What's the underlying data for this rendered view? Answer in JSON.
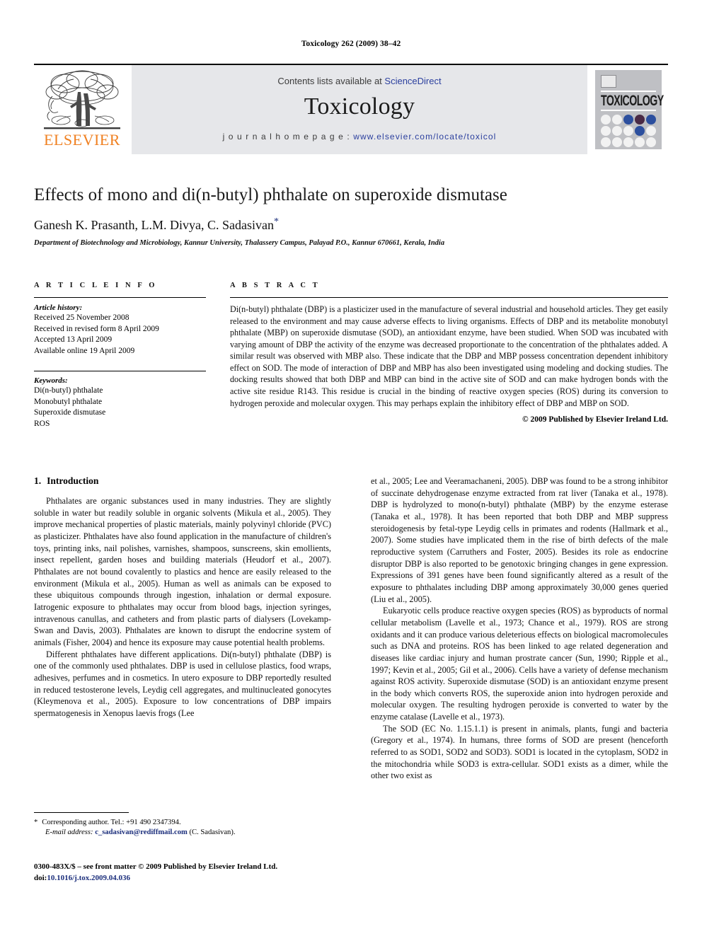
{
  "running_head": "Toxicology 262 (2009) 38–42",
  "masthead": {
    "contents_prefix": "Contents lists available at ",
    "contents_link": "ScienceDirect",
    "journal_name": "Toxicology",
    "homepage_prefix": "j o u r n a l   h o m e p a g e :  ",
    "homepage_url": "www.elsevier.com/locate/toxicol",
    "publisher_logo_text": "ELSEVIER",
    "cover_title": "TOXICOLOGY",
    "accent_orange": "#f08122",
    "link_blue": "#2b3f9e",
    "band_gray": "#e6e7ea",
    "cover_gray": "#bfc0c4",
    "dot_blue": "#2c4f9e",
    "dot_plum": "#4a2a45"
  },
  "title_block": {
    "title": "Effects of mono and di(n-butyl) phthalate on superoxide dismutase",
    "authors": "Ganesh K. Prasanth, L.M. Divya, C. Sadasivan",
    "corresponding_mark": "*",
    "affiliation": "Department of Biotechnology and Microbiology, Kannur University, Thalassery Campus, Palayad P.O., Kannur 670661, Kerala, India"
  },
  "article_info": {
    "heading": "A R T I C L E   I N F O",
    "history_label": "Article history:",
    "history": [
      "Received 25 November 2008",
      "Received in revised form 8 April 2009",
      "Accepted 13 April 2009",
      "Available online 19 April 2009"
    ],
    "keywords_label": "Keywords:",
    "keywords": [
      "Di(n-butyl) phthalate",
      "Monobutyl phthalate",
      "Superoxide dismutase",
      "ROS"
    ]
  },
  "abstract": {
    "heading": "A B S T R A C T",
    "text": "Di(n-butyl) phthalate (DBP) is a plasticizer used in the manufacture of several industrial and household articles. They get easily released to the environment and may cause adverse effects to living organisms. Effects of DBP and its metabolite monobutyl phthalate (MBP) on superoxide dismutase (SOD), an antioxidant enzyme, have been studied. When SOD was incubated with varying amount of DBP the activity of the enzyme was decreased proportionate to the concentration of the phthalates added. A similar result was observed with MBP also. These indicate that the DBP and MBP possess concentration dependent inhibitory effect on SOD. The mode of interaction of DBP and MBP has also been investigated using modeling and docking studies. The docking results showed that both DBP and MBP can bind in the active site of SOD and can make hydrogen bonds with the active site residue R143. This residue is crucial in the binding of reactive oxygen species (ROS) during its conversion to hydrogen peroxide and molecular oxygen. This may perhaps explain the inhibitory effect of DBP and MBP on SOD.",
    "copyright": "© 2009 Published by Elsevier Ireland Ltd."
  },
  "introduction": {
    "number": "1.",
    "title": "Introduction",
    "left_paragraphs": [
      "Phthalates are organic substances used in many industries. They are slightly soluble in water but readily soluble in organic solvents (Mikula et al., 2005). They improve mechanical properties of plastic materials, mainly polyvinyl chloride (PVC) as plasticizer. Phthalates have also found application in the manufacture of children's toys, printing inks, nail polishes, varnishes, shampoos, sunscreens, skin emollients, insect repellent, garden hoses and building materials (Heudorf et al., 2007). Phthalates are not bound covalently to plastics and hence are easily released to the environment (Mikula et al., 2005). Human as well as animals can be exposed to these ubiquitous compounds through ingestion, inhalation or dermal exposure. Iatrogenic exposure to phthalates may occur from blood bags, injection syringes, intravenous canullas, and catheters and from plastic parts of dialysers (Lovekamp-Swan and Davis, 2003). Phthalates are known to disrupt the endocrine system of animals (Fisher, 2004) and hence its exposure may cause potential health problems.",
      "Different phthalates have different applications. Di(n-butyl) phthalate (DBP) is one of the commonly used phthalates. DBP is used in cellulose plastics, food wraps, adhesives, perfumes and in cosmetics. In utero exposure to DBP reportedly resulted in reduced testosterone levels, Leydig cell aggregates, and multinucleated gonocytes (Kleymenova et al., 2005). Exposure to low concentrations of DBP impairs spermatogenesis in Xenopus laevis frogs (Lee"
    ],
    "right_paragraphs": [
      "et al., 2005; Lee and Veeramachaneni, 2005). DBP was found to be a strong inhibitor of succinate dehydrogenase enzyme extracted from rat liver (Tanaka et al., 1978). DBP is hydrolyzed to mono(n-butyl) phthalate (MBP) by the enzyme esterase (Tanaka et al., 1978). It has been reported that both DBP and MBP suppress steroidogenesis by fetal-type Leydig cells in primates and rodents (Hallmark et al., 2007). Some studies have implicated them in the rise of birth defects of the male reproductive system (Carruthers and Foster, 2005). Besides its role as endocrine disruptor DBP is also reported to be genotoxic bringing changes in gene expression. Expressions of 391 genes have been found significantly altered as a result of the exposure to phthalates including DBP among approximately 30,000 genes queried (Liu et al., 2005).",
      "Eukaryotic cells produce reactive oxygen species (ROS) as byproducts of normal cellular metabolism (Lavelle et al., 1973; Chance et al., 1979). ROS are strong oxidants and it can produce various deleterious effects on biological macromolecules such as DNA and proteins. ROS has been linked to age related degeneration and diseases like cardiac injury and human prostrate cancer (Sun, 1990; Ripple et al., 1997; Kevin et al., 2005; Gil et al., 2006). Cells have a variety of defense mechanism against ROS activity. Superoxide dismutase (SOD) is an antioxidant enzyme present in the body which converts ROS, the superoxide anion into hydrogen peroxide and molecular oxygen. The resulting hydrogen peroxide is converted to water by the enzyme catalase (Lavelle et al., 1973).",
      "The SOD (EC No. 1.15.1.1) is present in animals, plants, fungi and bacteria (Gregory et al., 1974). In humans, three forms of SOD are present (henceforth referred to as SOD1, SOD2 and SOD3). SOD1 is located in the cytoplasm, SOD2 in the mitochondria while SOD3 is extra-cellular. SOD1 exists as a dimer, while the other two exist as"
    ]
  },
  "footnotes": {
    "corresponding_mark": "*",
    "corresponding_text": "Corresponding author. Tel.: +91 490 2347394.",
    "email_label": "E-mail address:",
    "email": "c_sadasivan@rediffmail.com",
    "email_owner": "(C. Sadasivan)."
  },
  "imprint": {
    "line1": "0300-483X/$ – see front matter © 2009 Published by Elsevier Ireland Ltd.",
    "doi_label": "doi:",
    "doi": "10.1016/j.tox.2009.04.036"
  }
}
